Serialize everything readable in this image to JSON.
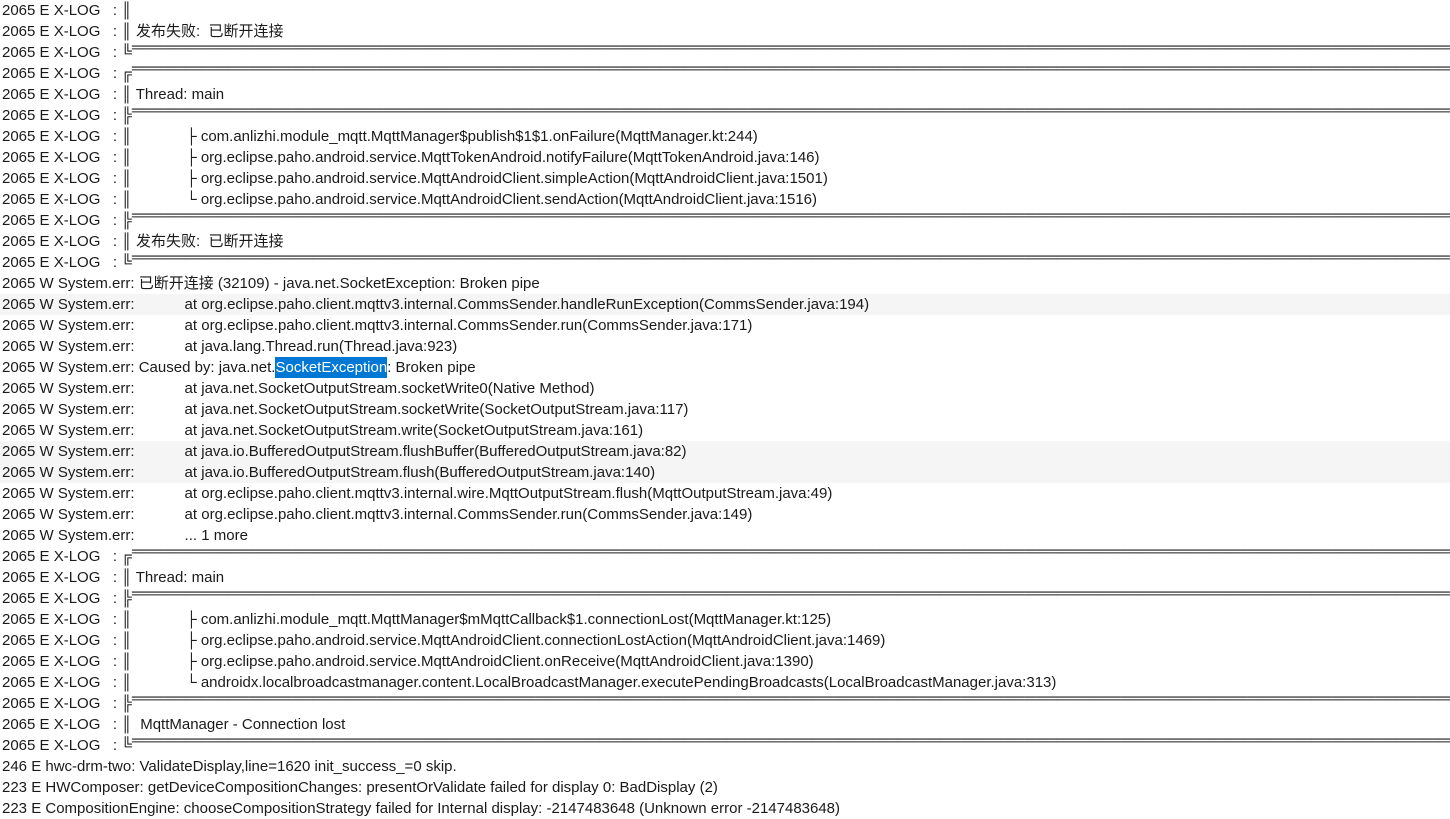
{
  "lines": [
    {
      "pid": "2065",
      "level": "E",
      "tag": "X-LOG",
      "sep": ":",
      "body": " ║",
      "hl": false
    },
    {
      "pid": "2065",
      "level": "E",
      "tag": "X-LOG",
      "sep": ":",
      "body": " ║ 发布失败:  已断开连接",
      "hl": false
    },
    {
      "pid": "2065",
      "level": "E",
      "tag": "X-LOG",
      "sep": ":",
      "body": " ╚",
      "hline_after": true,
      "hl": false
    },
    {
      "pid": "2065",
      "level": "E",
      "tag": "X-LOG",
      "sep": ":",
      "body": " ╔",
      "hline_after": true,
      "hl": false
    },
    {
      "pid": "2065",
      "level": "E",
      "tag": "X-LOG",
      "sep": ":",
      "body": " ║ Thread: main",
      "hl": false
    },
    {
      "pid": "2065",
      "level": "E",
      "tag": "X-LOG",
      "sep": ":",
      "body": " ╠",
      "hline_after": true,
      "hl": false
    },
    {
      "pid": "2065",
      "level": "E",
      "tag": "X-LOG",
      "sep": ":",
      "body": " ║             ├ com.anlizhi.module_mqtt.MqttManager$publish$1$1.onFailure(MqttManager.kt:244)",
      "hl": false
    },
    {
      "pid": "2065",
      "level": "E",
      "tag": "X-LOG",
      "sep": ":",
      "body": " ║             ├ org.eclipse.paho.android.service.MqttTokenAndroid.notifyFailure(MqttTokenAndroid.java:146)",
      "hl": false
    },
    {
      "pid": "2065",
      "level": "E",
      "tag": "X-LOG",
      "sep": ":",
      "body": " ║             ├ org.eclipse.paho.android.service.MqttAndroidClient.simpleAction(MqttAndroidClient.java:1501)",
      "hl": false
    },
    {
      "pid": "2065",
      "level": "E",
      "tag": "X-LOG",
      "sep": ":",
      "body": " ║             └ org.eclipse.paho.android.service.MqttAndroidClient.sendAction(MqttAndroidClient.java:1516)",
      "hl": false
    },
    {
      "pid": "2065",
      "level": "E",
      "tag": "X-LOG",
      "sep": ":",
      "body": " ╠",
      "hline_after": true,
      "hl": false
    },
    {
      "pid": "2065",
      "level": "E",
      "tag": "X-LOG",
      "sep": ":",
      "body": " ║ 发布失败:  已断开连接",
      "hl": false
    },
    {
      "pid": "2065",
      "level": "E",
      "tag": "X-LOG",
      "sep": ":",
      "body": " ╚",
      "hline_after": true,
      "hl": false
    },
    {
      "pid": "2065",
      "level": "W",
      "tag": "System.err",
      "sep": ":",
      "body": " 已断开连接 (32109) - java.net.SocketException: Broken pipe",
      "hl": false
    },
    {
      "pid": "2065",
      "level": "W",
      "tag": "System.err",
      "sep": ":",
      "body": "            at org.eclipse.paho.client.mqttv3.internal.CommsSender.handleRunException(CommsSender.java:194)",
      "hl": true
    },
    {
      "pid": "2065",
      "level": "W",
      "tag": "System.err",
      "sep": ":",
      "body": "            at org.eclipse.paho.client.mqttv3.internal.CommsSender.run(CommsSender.java:171)",
      "hl": false
    },
    {
      "pid": "2065",
      "level": "W",
      "tag": "System.err",
      "sep": ":",
      "body": "            at java.lang.Thread.run(Thread.java:923)",
      "hl": false
    },
    {
      "pid": "2065",
      "level": "W",
      "tag": "System.err",
      "sep": ":",
      "body_segments": [
        " Caused by: java.net.",
        "SocketException",
        ": Broken pipe"
      ],
      "selection_index": 1,
      "hl": false
    },
    {
      "pid": "2065",
      "level": "W",
      "tag": "System.err",
      "sep": ":",
      "body": "            at java.net.SocketOutputStream.socketWrite0(Native Method)",
      "hl": false
    },
    {
      "pid": "2065",
      "level": "W",
      "tag": "System.err",
      "sep": ":",
      "body": "            at java.net.SocketOutputStream.socketWrite(SocketOutputStream.java:117)",
      "hl": false
    },
    {
      "pid": "2065",
      "level": "W",
      "tag": "System.err",
      "sep": ":",
      "body": "            at java.net.SocketOutputStream.write(SocketOutputStream.java:161)",
      "hl": false
    },
    {
      "pid": "2065",
      "level": "W",
      "tag": "System.err",
      "sep": ":",
      "body": "            at java.io.BufferedOutputStream.flushBuffer(BufferedOutputStream.java:82)",
      "hl": true
    },
    {
      "pid": "2065",
      "level": "W",
      "tag": "System.err",
      "sep": ":",
      "body": "            at java.io.BufferedOutputStream.flush(BufferedOutputStream.java:140)",
      "hl": true
    },
    {
      "pid": "2065",
      "level": "W",
      "tag": "System.err",
      "sep": ":",
      "body": "            at org.eclipse.paho.client.mqttv3.internal.wire.MqttOutputStream.flush(MqttOutputStream.java:49)",
      "hl": false
    },
    {
      "pid": "2065",
      "level": "W",
      "tag": "System.err",
      "sep": ":",
      "body": "            at org.eclipse.paho.client.mqttv3.internal.CommsSender.run(CommsSender.java:149)",
      "hl": false
    },
    {
      "pid": "2065",
      "level": "W",
      "tag": "System.err",
      "sep": ":",
      "body": "            ... 1 more",
      "hl": false
    },
    {
      "pid": "2065",
      "level": "E",
      "tag": "X-LOG",
      "sep": ":",
      "body": " ╔",
      "hline_after": true,
      "hl": false
    },
    {
      "pid": "2065",
      "level": "E",
      "tag": "X-LOG",
      "sep": ":",
      "body": " ║ Thread: main",
      "hl": false
    },
    {
      "pid": "2065",
      "level": "E",
      "tag": "X-LOG",
      "sep": ":",
      "body": " ╠",
      "hline_after": true,
      "hl": false
    },
    {
      "pid": "2065",
      "level": "E",
      "tag": "X-LOG",
      "sep": ":",
      "body": " ║             ├ com.anlizhi.module_mqtt.MqttManager$mMqttCallback$1.connectionLost(MqttManager.kt:125)",
      "hl": false
    },
    {
      "pid": "2065",
      "level": "E",
      "tag": "X-LOG",
      "sep": ":",
      "body": " ║             ├ org.eclipse.paho.android.service.MqttAndroidClient.connectionLostAction(MqttAndroidClient.java:1469)",
      "hl": false
    },
    {
      "pid": "2065",
      "level": "E",
      "tag": "X-LOG",
      "sep": ":",
      "body": " ║             ├ org.eclipse.paho.android.service.MqttAndroidClient.onReceive(MqttAndroidClient.java:1390)",
      "hl": false
    },
    {
      "pid": "2065",
      "level": "E",
      "tag": "X-LOG",
      "sep": ":",
      "body": " ║             └ androidx.localbroadcastmanager.content.LocalBroadcastManager.executePendingBroadcasts(LocalBroadcastManager.java:313)",
      "hl": false
    },
    {
      "pid": "2065",
      "level": "E",
      "tag": "X-LOG",
      "sep": ":",
      "body": " ╠",
      "hline_after": true,
      "hl": false
    },
    {
      "pid": "2065",
      "level": "E",
      "tag": "X-LOG",
      "sep": ":",
      "body": " ║  MqttManager - Connection lost",
      "hl": false
    },
    {
      "pid": "2065",
      "level": "E",
      "tag": "X-LOG",
      "sep": ":",
      "body": " ╚",
      "hline_after": true,
      "hl": false
    },
    {
      "pid": "246",
      "level": "E",
      "tag": "hwc-drm-two",
      "sep": ":",
      "body": " ValidateDisplay,line=1620 init_success_=0 skip.",
      "hl": false
    },
    {
      "pid": "223",
      "level": "E",
      "tag": "HWComposer",
      "sep": ":",
      "body": " getDeviceCompositionChanges: presentOrValidate failed for display 0: BadDisplay (2)",
      "hl": false
    },
    {
      "pid": "223",
      "level": "E",
      "tag": "CompositionEngine",
      "sep": ":",
      "body": " chooseCompositionStrategy failed for Internal display: -2147483648 (Unknown error -2147483648)",
      "hl": false
    }
  ]
}
